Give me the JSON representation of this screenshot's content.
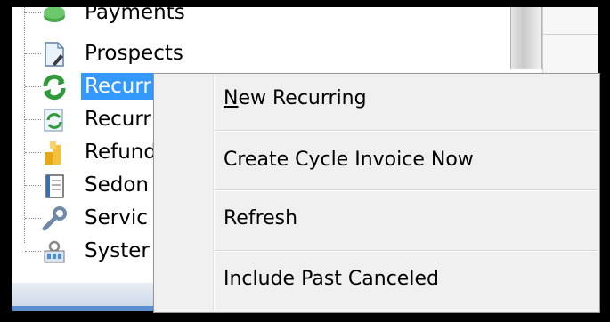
{
  "tree": {
    "items": [
      {
        "label": "Payments",
        "icon": "payments-icon"
      },
      {
        "label": "Prospects",
        "icon": "prospects-icon"
      },
      {
        "label": "Recurr",
        "icon": "recurring-icon",
        "selected": true
      },
      {
        "label": "Recurr",
        "icon": "recurring-invoice-icon"
      },
      {
        "label": "Refund",
        "icon": "refund-icon"
      },
      {
        "label": "Sedon",
        "icon": "sedona-icon"
      },
      {
        "label": "Servic",
        "icon": "service-icon"
      },
      {
        "label": "Syster",
        "icon": "system-icon"
      }
    ]
  },
  "context_menu": {
    "items": [
      {
        "accel": "N",
        "rest": "ew Recurring"
      },
      {
        "label": "Create Cycle Invoice Now"
      },
      {
        "label": "Refresh"
      },
      {
        "label": "Include Past Canceled"
      }
    ]
  },
  "colors": {
    "selection": "#3399ff",
    "menu_bg": "#f0f0f0",
    "frame_border": "#000000"
  }
}
